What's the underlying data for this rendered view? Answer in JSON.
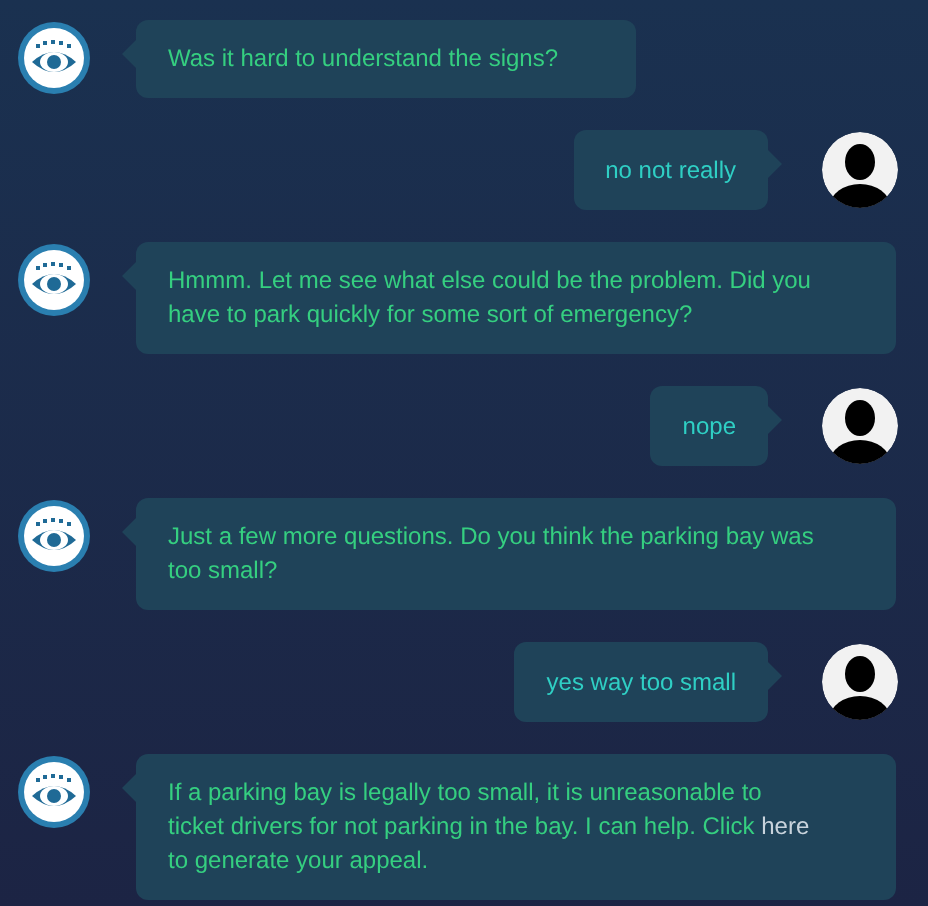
{
  "messages": [
    {
      "kind": "bot",
      "text": "Was it hard to understand the signs?"
    },
    {
      "kind": "user",
      "text": "no not really"
    },
    {
      "kind": "bot",
      "text": "Hmmm. Let me see what else could be the problem. Did you have to park quickly for some sort of emergency?"
    },
    {
      "kind": "user",
      "text": "nope"
    },
    {
      "kind": "bot",
      "text": "Just a few more questions. Do you think the parking bay was too small?"
    },
    {
      "kind": "user",
      "text": "yes way too small"
    },
    {
      "kind": "bot",
      "text": "If a parking bay is legally too small, it is unreasonable to ticket drivers for not parking in the bay. I can help. Click",
      "link": "here",
      "text_after": "to generate your appeal."
    }
  ]
}
